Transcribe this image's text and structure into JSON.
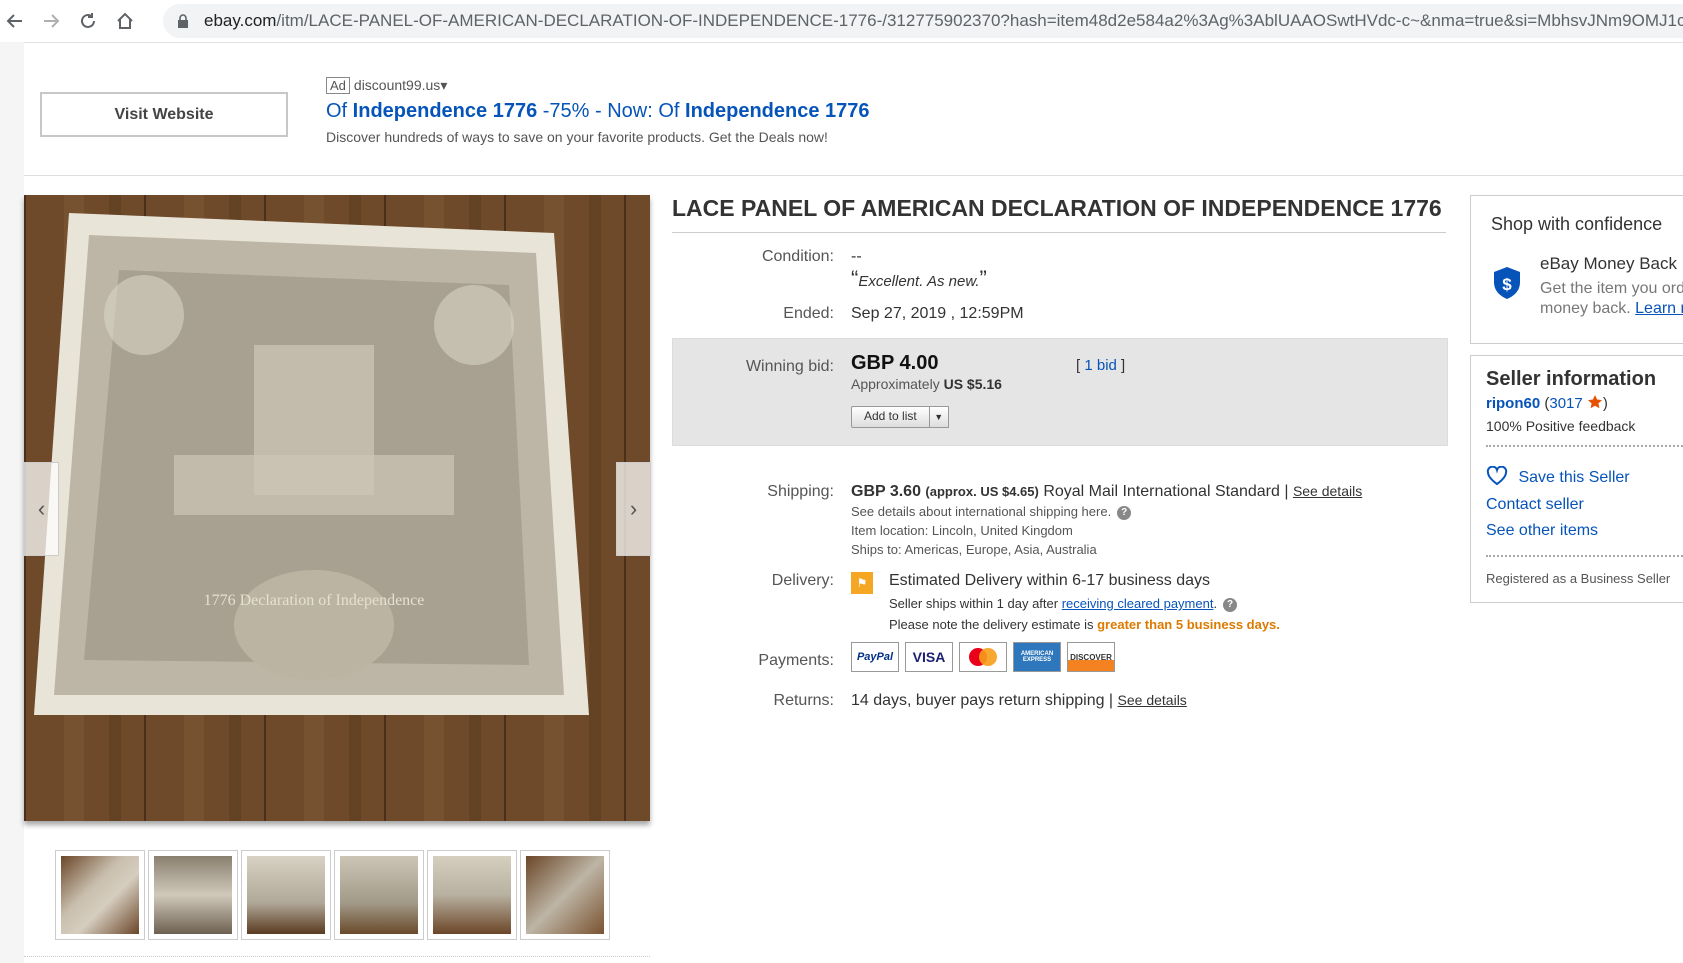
{
  "browser": {
    "url_domain": "ebay.com",
    "url_path": "/itm/LACE-PANEL-OF-AMERICAN-DECLARATION-OF-INDEPENDENCE-1776-/312775902370?hash=item48d2e584a2%3Ag%3AblUAAOSwtHVdc-c~&nma=true&si=MbhsvJNm9OMJ1c"
  },
  "ad": {
    "visit_button": "Visit Website",
    "badge": "Ad",
    "domain": "discount99.us",
    "domain_caret": "▾",
    "title_part1": "Of ",
    "title_part2": "Independence 1776",
    "title_part3": " -75% - Now: Of ",
    "title_part4": "Independence 1776",
    "description": "Discover hundreds of ways to save on your favorite products. Get the Deals now!"
  },
  "gallery": {
    "prev_icon": "‹",
    "next_icon": "›",
    "lace_text": "1776 Declaration of Independence",
    "thumbnail_count": 6
  },
  "item": {
    "title": "LACE PANEL OF AMERICAN DECLARATION OF INDEPENDENCE 1776",
    "condition_label": "Condition:",
    "condition_value": "--",
    "condition_quote": "Excellent. As new.",
    "ended_label": "Ended:",
    "ended_value": "Sep 27, 2019 , 12:59PM",
    "winning_bid_label": "Winning bid:",
    "winning_bid_value": "GBP 4.00",
    "approx_prefix": "Approximately ",
    "approx_value": "US $5.16",
    "bid_count_open": "[ ",
    "bid_count_link": "1 bid",
    "bid_count_close": " ]",
    "add_to_list": "Add to list",
    "shipping_label": "Shipping:",
    "shipping_price": "GBP 3.60",
    "shipping_approx": "(approx. US $4.65)",
    "shipping_service": "Royal Mail International Standard | ",
    "see_details": "See details",
    "shipping_intl": "See details about international shipping here.",
    "item_location": "Item location:  Lincoln, United Kingdom",
    "ships_to": "Ships to:  Americas, Europe, Asia, Australia",
    "delivery_label": "Delivery:",
    "delivery_estimate": "Estimated Delivery within 6-17 business days",
    "delivery_ships_prefix": "Seller ships within 1 day after ",
    "delivery_ships_link": "receiving cleared payment",
    "delivery_note_prefix": "Please note the delivery estimate is ",
    "delivery_note_emph": "greater than 5 business days.",
    "payments_label": "Payments:",
    "payment_methods": [
      "PayPal",
      "VISA",
      "Mastercard",
      "AMERICAN EXPRESS",
      "DISCOVER"
    ],
    "returns_label": "Returns:",
    "returns_value": "14 days, buyer pays return shipping | ",
    "returns_see_details": "See details"
  },
  "confidence": {
    "title": "Shop with confidence",
    "guarantee_title": "eBay Money Back",
    "guarantee_text1": "Get the item you ord",
    "guarantee_text2": "money back. ",
    "learn_link": "Learn r"
  },
  "seller": {
    "title": "Seller information",
    "name": "ripon60",
    "feedback_open": " (",
    "feedback_score": "3017",
    "feedback_close": ")",
    "positive": "100% Positive feedback",
    "save_seller": "Save this Seller",
    "contact": "Contact seller",
    "other_items": "See other items",
    "registered": "Registered as a Business Seller"
  },
  "colors": {
    "link": "#0654ba",
    "orange": "#dd7a00"
  }
}
